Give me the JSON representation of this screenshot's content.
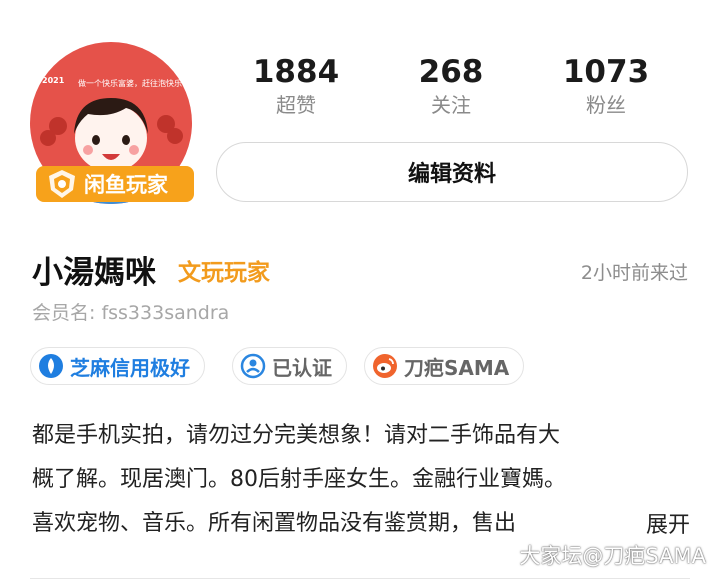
{
  "profile": {
    "avatar_text": "做一个快乐富婆，赶往泡快乐",
    "avatar_year": "2021",
    "player_badge": "闲鱼玩家",
    "name": "小湯媽咪",
    "tag": "文玩玩家",
    "last_seen": "2小时前来过",
    "member_label": "会员名: fss333sandra"
  },
  "stats": [
    {
      "value": "1884",
      "label": "超赞"
    },
    {
      "value": "268",
      "label": "关注"
    },
    {
      "value": "1073",
      "label": "粉丝"
    }
  ],
  "actions": {
    "edit_label": "编辑资料"
  },
  "badges": [
    {
      "label": "芝麻信用极好",
      "icon": "sesame-credit-icon"
    },
    {
      "label": "已认证",
      "icon": "verified-icon"
    },
    {
      "label": "刀疤SAMA",
      "icon": "weibo-icon"
    }
  ],
  "bio": {
    "lines": [
      "都是手机实拍，请勿过分完美想象！请对二手饰品有大",
      "概了解。现居澳门。80后射手座女生。金融行业寶媽。",
      "喜欢宠物、音乐。所有闲置物品没有鉴赏期，售出"
    ],
    "expand_label": "展开"
  },
  "watermark": "大家坛@刀疤SAMA",
  "colors": {
    "accent_orange": "#f29b1d",
    "credit_blue": "#1f7ee0",
    "avatar_red": "#e5524a"
  }
}
